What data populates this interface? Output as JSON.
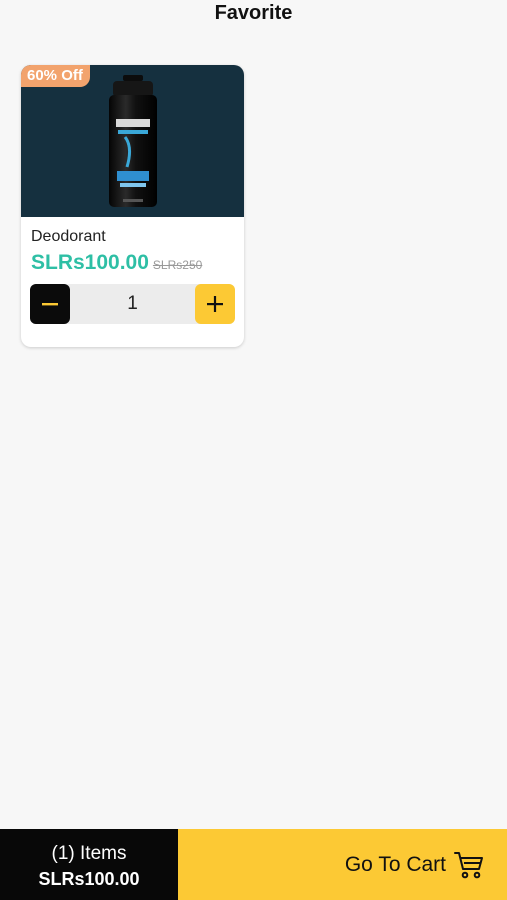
{
  "header": {
    "title": "Favorite"
  },
  "product": {
    "badge": "60% Off",
    "name": "Deodorant",
    "price": "SLRs100.00",
    "original_price": "SLRs250",
    "quantity": "1",
    "image_icon": "deodorant-product-photo"
  },
  "bottom_bar": {
    "items_count": "(1) Items",
    "total": "SLRs100.00",
    "cart_label": "Go To Cart",
    "cart_icon": "cart-icon"
  },
  "colors": {
    "badge": "#f2a36d",
    "price": "#2ebfa5",
    "accent": "#fcc934",
    "dark": "#080808",
    "image_bg": "#15303f"
  }
}
